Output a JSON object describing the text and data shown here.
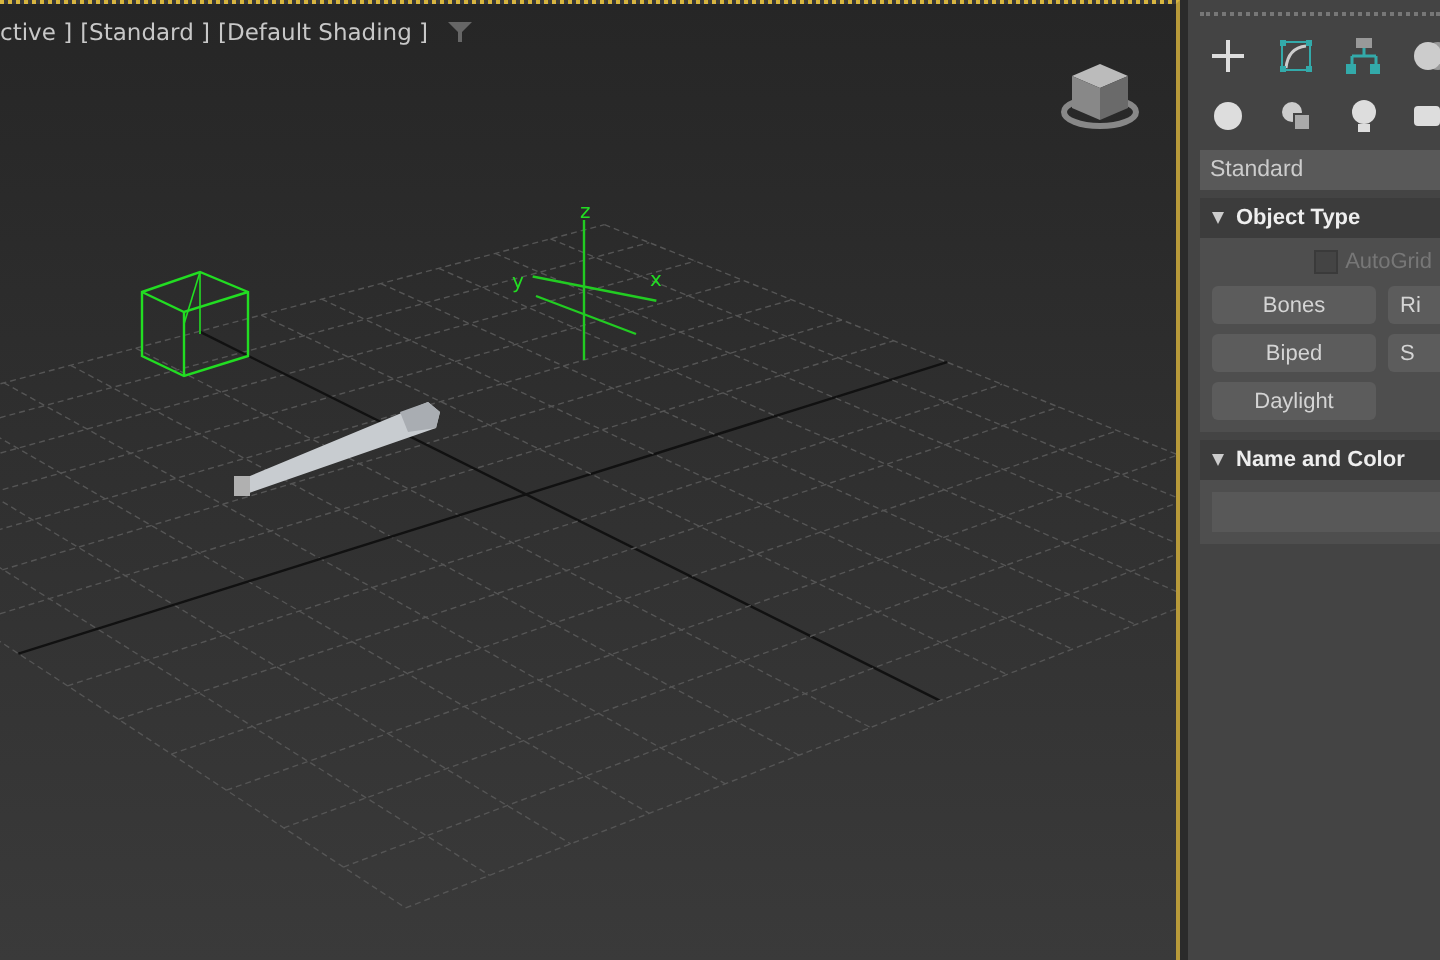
{
  "viewport": {
    "labels": [
      "ctive ]",
      "[Standard ]",
      "[Default Shading ]"
    ],
    "active": true,
    "gizmo_labels": [
      "z",
      "y",
      "x"
    ]
  },
  "command_panel": {
    "dropdown": {
      "value": "Standard"
    },
    "rollouts": [
      {
        "title": "Object Type",
        "expanded": true,
        "autogrid": {
          "label": "AutoGrid",
          "checked": false,
          "disabled": true
        },
        "buttons": [
          "Bones",
          "Ri",
          "Biped",
          "S",
          "Daylight"
        ]
      },
      {
        "title": "Name and Color",
        "expanded": true
      }
    ]
  }
}
